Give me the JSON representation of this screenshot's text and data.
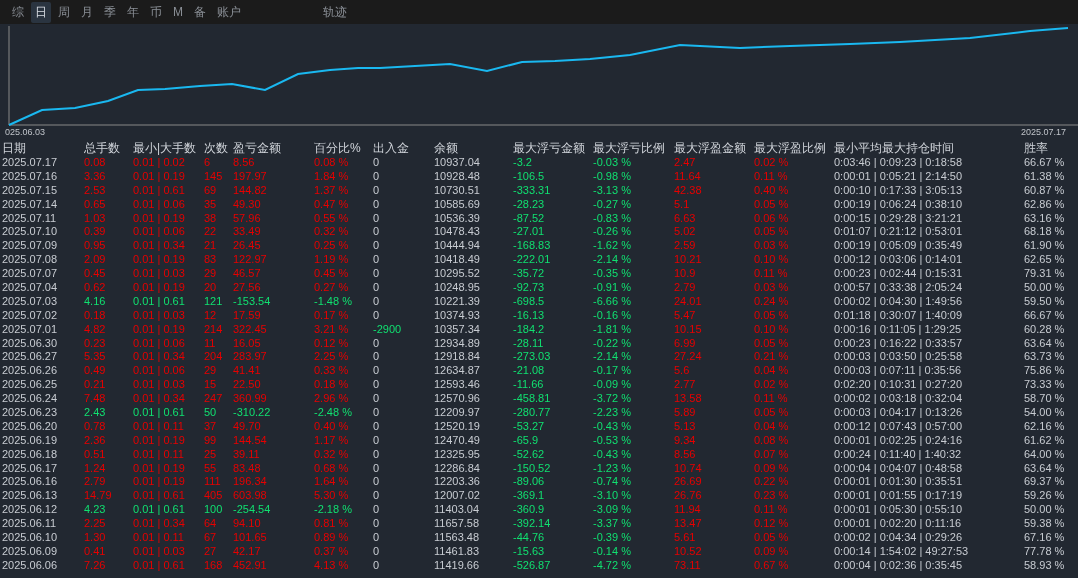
{
  "tabs": [
    {
      "label": "综",
      "selected": false
    },
    {
      "label": "日",
      "selected": true
    },
    {
      "label": "周",
      "selected": false
    },
    {
      "label": "月",
      "selected": false
    },
    {
      "label": "季",
      "selected": false
    },
    {
      "label": "年",
      "selected": false
    },
    {
      "label": "币",
      "selected": false
    },
    {
      "label": "M",
      "selected": false
    },
    {
      "label": "备",
      "selected": false
    },
    {
      "label": "账户",
      "selected": false
    }
  ],
  "chart_tab": "轨迹",
  "chart": {
    "start_label": "025.06.03",
    "end_label": "2025.07.17"
  },
  "table": {
    "columns": [
      "日期",
      "总手数",
      "最小|大手数",
      "次数",
      "盈亏金额",
      "百分比%",
      "出入金",
      "余额",
      "最大浮亏金额",
      "最大浮亏比例",
      "最大浮盈金额",
      "最大浮盈比例",
      "最小平均最大持仓时间",
      "胜率"
    ],
    "rows": [
      {
        "cells": [
          "2025.07.17",
          "0.08",
          "0.01 | 0.02",
          "6",
          "8.56",
          "0.08 %",
          "0",
          "10937.04",
          "-3.2",
          "-0.03 %",
          "2.47",
          "0.02 %",
          "0:03:46 | 0:09:23 | 0:18:58",
          "66.67 %"
        ],
        "loss": false,
        "withdrawal": false
      },
      {
        "cells": [
          "2025.07.16",
          "3.36",
          "0.01 | 0.19",
          "145",
          "197.97",
          "1.84 %",
          "0",
          "10928.48",
          "-106.5",
          "-0.98 %",
          "11.64",
          "0.11 %",
          "0:00:01 | 0:05:21 | 2:14:50",
          "61.38 %"
        ],
        "loss": false,
        "withdrawal": false
      },
      {
        "cells": [
          "2025.07.15",
          "2.53",
          "0.01 | 0.61",
          "69",
          "144.82",
          "1.37 %",
          "0",
          "10730.51",
          "-333.31",
          "-3.13 %",
          "42.38",
          "0.40 %",
          "0:00:10 | 0:17:33 | 3:05:13",
          "60.87 %"
        ],
        "loss": false,
        "withdrawal": false
      },
      {
        "cells": [
          "2025.07.14",
          "0.65",
          "0.01 | 0.06",
          "35",
          "49.30",
          "0.47 %",
          "0",
          "10585.69",
          "-28.23",
          "-0.27 %",
          "5.1",
          "0.05 %",
          "0:00:19 | 0:06:24 | 0:38:10",
          "62.86 %"
        ],
        "loss": false,
        "withdrawal": false
      },
      {
        "cells": [
          "2025.07.11",
          "1.03",
          "0.01 | 0.19",
          "38",
          "57.96",
          "0.55 %",
          "0",
          "10536.39",
          "-87.52",
          "-0.83 %",
          "6.63",
          "0.06 %",
          "0:00:15 | 0:29:28 | 3:21:21",
          "63.16 %"
        ],
        "loss": false,
        "withdrawal": false
      },
      {
        "cells": [
          "2025.07.10",
          "0.39",
          "0.01 | 0.06",
          "22",
          "33.49",
          "0.32 %",
          "0",
          "10478.43",
          "-27.01",
          "-0.26 %",
          "5.02",
          "0.05 %",
          "0:01:07 | 0:21:12 | 0:53:01",
          "68.18 %"
        ],
        "loss": false,
        "withdrawal": false
      },
      {
        "cells": [
          "2025.07.09",
          "0.95",
          "0.01 | 0.34",
          "21",
          "26.45",
          "0.25 %",
          "0",
          "10444.94",
          "-168.83",
          "-1.62 %",
          "2.59",
          "0.03 %",
          "0:00:19 | 0:05:09 | 0:35:49",
          "61.90 %"
        ],
        "loss": false,
        "withdrawal": false
      },
      {
        "cells": [
          "2025.07.08",
          "2.09",
          "0.01 | 0.19",
          "83",
          "122.97",
          "1.19 %",
          "0",
          "10418.49",
          "-222.01",
          "-2.14 %",
          "10.21",
          "0.10 %",
          "0:00:12 | 0:03:06 | 0:14:01",
          "62.65 %"
        ],
        "loss": false,
        "withdrawal": false
      },
      {
        "cells": [
          "2025.07.07",
          "0.45",
          "0.01 | 0.03",
          "29",
          "46.57",
          "0.45 %",
          "0",
          "10295.52",
          "-35.72",
          "-0.35 %",
          "10.9",
          "0.11 %",
          "0:00:23 | 0:02:44 | 0:15:31",
          "79.31 %"
        ],
        "loss": false,
        "withdrawal": false
      },
      {
        "cells": [
          "2025.07.04",
          "0.62",
          "0.01 | 0.19",
          "20",
          "27.56",
          "0.27 %",
          "0",
          "10248.95",
          "-92.73",
          "-0.91 %",
          "2.79",
          "0.03 %",
          "0:00:57 | 0:33:38 | 2:05:24",
          "50.00 %"
        ],
        "loss": false,
        "withdrawal": false
      },
      {
        "cells": [
          "2025.07.03",
          "4.16",
          "0.01 | 0.61",
          "121",
          "-153.54",
          "-1.48 %",
          "0",
          "10221.39",
          "-698.5",
          "-6.66 %",
          "24.01",
          "0.24 %",
          "0:00:02 | 0:04:30 | 1:49:56",
          "59.50 %"
        ],
        "loss": true,
        "withdrawal": false
      },
      {
        "cells": [
          "2025.07.02",
          "0.18",
          "0.01 | 0.03",
          "12",
          "17.59",
          "0.17 %",
          "0",
          "10374.93",
          "-16.13",
          "-0.16 %",
          "5.47",
          "0.05 %",
          "0:01:18 | 0:30:07 | 1:40:09",
          "66.67 %"
        ],
        "loss": false,
        "withdrawal": false
      },
      {
        "cells": [
          "2025.07.01",
          "4.82",
          "0.01 | 0.19",
          "214",
          "322.45",
          "3.21 %",
          "-2900",
          "10357.34",
          "-184.2",
          "-1.81 %",
          "10.15",
          "0.10 %",
          "0:00:16 | 0:11:05 | 1:29:25",
          "60.28 %"
        ],
        "loss": false,
        "withdrawal": true
      },
      {
        "cells": [
          "2025.06.30",
          "0.23",
          "0.01 | 0.06",
          "11",
          "16.05",
          "0.12 %",
          "0",
          "12934.89",
          "-28.11",
          "-0.22 %",
          "6.99",
          "0.05 %",
          "0:00:23 | 0:16:22 | 0:33:57",
          "63.64 %"
        ],
        "loss": false,
        "withdrawal": false
      },
      {
        "cells": [
          "2025.06.27",
          "5.35",
          "0.01 | 0.34",
          "204",
          "283.97",
          "2.25 %",
          "0",
          "12918.84",
          "-273.03",
          "-2.14 %",
          "27.24",
          "0.21 %",
          "0:00:03 | 0:03:50 | 0:25:58",
          "63.73 %"
        ],
        "loss": false,
        "withdrawal": false
      },
      {
        "cells": [
          "2025.06.26",
          "0.49",
          "0.01 | 0.06",
          "29",
          "41.41",
          "0.33 %",
          "0",
          "12634.87",
          "-21.08",
          "-0.17 %",
          "5.6",
          "0.04 %",
          "0:00:03 | 0:07:11 | 0:35:56",
          "75.86 %"
        ],
        "loss": false,
        "withdrawal": false
      },
      {
        "cells": [
          "2025.06.25",
          "0.21",
          "0.01 | 0.03",
          "15",
          "22.50",
          "0.18 %",
          "0",
          "12593.46",
          "-11.66",
          "-0.09 %",
          "2.77",
          "0.02 %",
          "0:02:20 | 0:10:31 | 0:27:20",
          "73.33 %"
        ],
        "loss": false,
        "withdrawal": false
      },
      {
        "cells": [
          "2025.06.24",
          "7.48",
          "0.01 | 0.34",
          "247",
          "360.99",
          "2.96 %",
          "0",
          "12570.96",
          "-458.81",
          "-3.72 %",
          "13.58",
          "0.11 %",
          "0:00:02 | 0:03:18 | 0:32:04",
          "58.70 %"
        ],
        "loss": false,
        "withdrawal": false
      },
      {
        "cells": [
          "2025.06.23",
          "2.43",
          "0.01 | 0.61",
          "50",
          "-310.22",
          "-2.48 %",
          "0",
          "12209.97",
          "-280.77",
          "-2.23 %",
          "5.89",
          "0.05 %",
          "0:00:03 | 0:04:17 | 0:13:26",
          "54.00 %"
        ],
        "loss": true,
        "withdrawal": false
      },
      {
        "cells": [
          "2025.06.20",
          "0.78",
          "0.01 | 0.11",
          "37",
          "49.70",
          "0.40 %",
          "0",
          "12520.19",
          "-53.27",
          "-0.43 %",
          "5.13",
          "0.04 %",
          "0:00:12 | 0:07:43 | 0:57:00",
          "62.16 %"
        ],
        "loss": false,
        "withdrawal": false
      },
      {
        "cells": [
          "2025.06.19",
          "2.36",
          "0.01 | 0.19",
          "99",
          "144.54",
          "1.17 %",
          "0",
          "12470.49",
          "-65.9",
          "-0.53 %",
          "9.34",
          "0.08 %",
          "0:00:01 | 0:02:25 | 0:24:16",
          "61.62 %"
        ],
        "loss": false,
        "withdrawal": false
      },
      {
        "cells": [
          "2025.06.18",
          "0.51",
          "0.01 | 0.11",
          "25",
          "39.11",
          "0.32 %",
          "0",
          "12325.95",
          "-52.62",
          "-0.43 %",
          "8.56",
          "0.07 %",
          "0:00:24 | 0:11:40 | 1:40:32",
          "64.00 %"
        ],
        "loss": false,
        "withdrawal": false
      },
      {
        "cells": [
          "2025.06.17",
          "1.24",
          "0.01 | 0.19",
          "55",
          "83.48",
          "0.68 %",
          "0",
          "12286.84",
          "-150.52",
          "-1.23 %",
          "10.74",
          "0.09 %",
          "0:00:04 | 0:04:07 | 0:48:58",
          "63.64 %"
        ],
        "loss": false,
        "withdrawal": false
      },
      {
        "cells": [
          "2025.06.16",
          "2.79",
          "0.01 | 0.19",
          "111",
          "196.34",
          "1.64 %",
          "0",
          "12203.36",
          "-89.06",
          "-0.74 %",
          "26.69",
          "0.22 %",
          "0:00:01 | 0:01:30 | 0:35:51",
          "69.37 %"
        ],
        "loss": false,
        "withdrawal": false
      },
      {
        "cells": [
          "2025.06.13",
          "14.79",
          "0.01 | 0.61",
          "405",
          "603.98",
          "5.30 %",
          "0",
          "12007.02",
          "-369.1",
          "-3.10 %",
          "26.76",
          "0.23 %",
          "0:00:01 | 0:01:55 | 0:17:19",
          "59.26 %"
        ],
        "loss": false,
        "withdrawal": false
      },
      {
        "cells": [
          "2025.06.12",
          "4.23",
          "0.01 | 0.61",
          "100",
          "-254.54",
          "-2.18 %",
          "0",
          "11403.04",
          "-360.9",
          "-3.09 %",
          "11.94",
          "0.11 %",
          "0:00:01 | 0:05:30 | 0:55:10",
          "50.00 %"
        ],
        "loss": true,
        "withdrawal": false
      },
      {
        "cells": [
          "2025.06.11",
          "2.25",
          "0.01 | 0.34",
          "64",
          "94.10",
          "0.81 %",
          "0",
          "11657.58",
          "-392.14",
          "-3.37 %",
          "13.47",
          "0.12 %",
          "0:00:01 | 0:02:20 | 0:11:16",
          "59.38 %"
        ],
        "loss": false,
        "withdrawal": false
      },
      {
        "cells": [
          "2025.06.10",
          "1.30",
          "0.01 | 0.11",
          "67",
          "101.65",
          "0.89 %",
          "0",
          "11563.48",
          "-44.76",
          "-0.39 %",
          "5.61",
          "0.05 %",
          "0:00:02 | 0:04:34 | 0:29:26",
          "67.16 %"
        ],
        "loss": false,
        "withdrawal": false
      },
      {
        "cells": [
          "2025.06.09",
          "0.41",
          "0.01 | 0.03",
          "27",
          "42.17",
          "0.37 %",
          "0",
          "11461.83",
          "-15.63",
          "-0.14 %",
          "10.52",
          "0.09 %",
          "0:00:14 | 1:54:02 | 49:27:53",
          "77.78 %"
        ],
        "loss": false,
        "withdrawal": false
      },
      {
        "cells": [
          "2025.06.06",
          "7.26",
          "0.01 | 0.61",
          "168",
          "452.91",
          "4.13 %",
          "0",
          "11419.66",
          "-526.87",
          "-4.72 %",
          "73.11",
          "0.67 %",
          "0:00:04 | 0:02:36 | 0:35:45",
          "58.93 %"
        ],
        "loss": false,
        "withdrawal": false
      }
    ]
  }
}
